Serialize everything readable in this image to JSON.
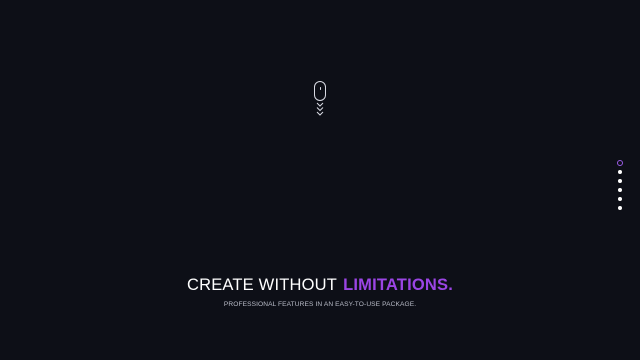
{
  "scroll_indicator": {
    "icon": "mouse-scroll-icon",
    "arrows_icon": "triple-chevron-down-icon"
  },
  "pager": {
    "dots": [
      {
        "state": "active"
      },
      {
        "state": "inactive"
      },
      {
        "state": "inactive"
      },
      {
        "state": "inactive"
      },
      {
        "state": "inactive"
      },
      {
        "state": "inactive"
      }
    ],
    "active_color": "#9a5ce6",
    "dot_color": "#ffffff"
  },
  "hero": {
    "headline_plain": "CREATE WITHOUT",
    "headline_accent": "LIMITATIONS.",
    "subline": "PROFESSIONAL FEATURES IN AN EASY-TO-USE PACKAGE."
  },
  "colors": {
    "background": "#0d0f17",
    "accent": "#9b45e4",
    "text": "#ffffff",
    "muted_text": "#b9bcc8"
  }
}
